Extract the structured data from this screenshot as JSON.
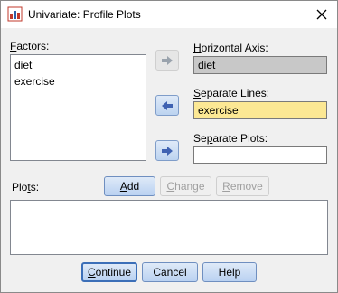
{
  "window": {
    "title": "Univariate: Profile Plots"
  },
  "factors": {
    "label": "Factors:",
    "items": [
      "diet",
      "exercise"
    ]
  },
  "horizontal_axis": {
    "label": "Horizontal Axis:",
    "value": "diet"
  },
  "separate_lines": {
    "label": "Separate Lines:",
    "value": "exercise"
  },
  "separate_plots": {
    "label": "Separate Plots:",
    "value": ""
  },
  "plots": {
    "label": "Plots:"
  },
  "buttons": {
    "add": "Add",
    "change": "Change",
    "remove": "Remove",
    "continue": "Continue",
    "cancel": "Cancel",
    "help": "Help"
  },
  "colors": {
    "accent_blue": "#3f62b2",
    "field_gray": "#c8c8c8",
    "field_yellow": "#fce894"
  }
}
